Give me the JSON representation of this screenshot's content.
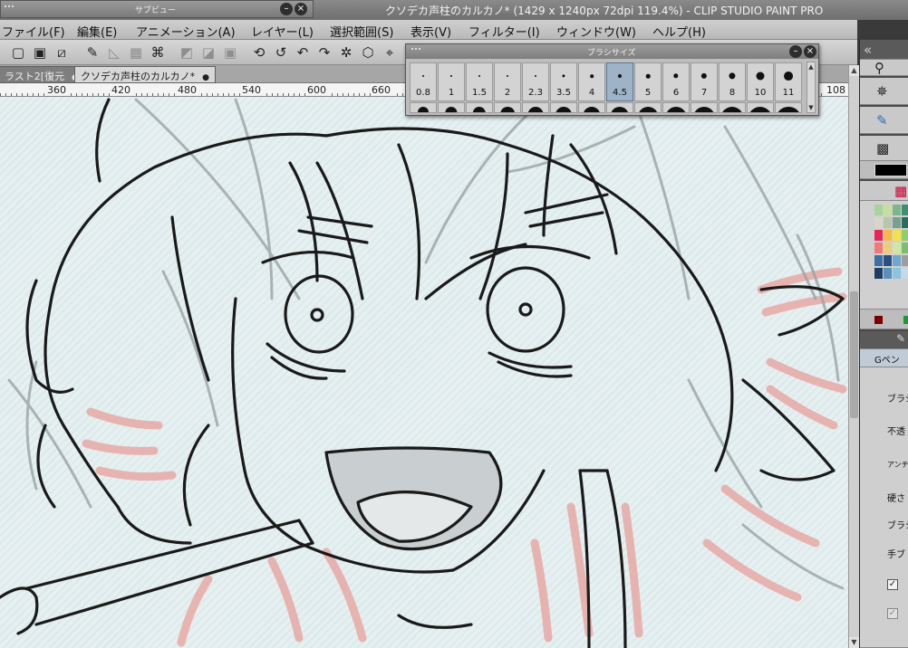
{
  "window": {
    "title": "クソデカ声柱のカルカノ* (1429 x 1240px 72dpi 119.4%)  - CLIP STUDIO PAINT PRO"
  },
  "subview": {
    "label": "サブビュー"
  },
  "menu": [
    "ファイル(F)",
    "編集(E)",
    "アニメーション(A)",
    "レイヤー(L)",
    "選択範囲(S)",
    "表示(V)",
    "フィルター(I)",
    "ウィンドウ(W)",
    "ヘルプ(H)"
  ],
  "tabs": [
    {
      "label": "ラスト2[復元",
      "active": false
    },
    {
      "label": "クソデカ声柱のカルカノ*",
      "active": true
    }
  ],
  "ruler": {
    "labels": [
      "360",
      "420",
      "480",
      "540",
      "600",
      "660",
      "108"
    ]
  },
  "brush_size_palette": {
    "title": "ブラシサイズ",
    "sizes": [
      "0.8",
      "1",
      "1.5",
      "2",
      "2.3",
      "3.5",
      "4",
      "4.5",
      "5",
      "6",
      "7",
      "8",
      "10",
      "11"
    ],
    "selected": "4.5"
  },
  "right_panel": {
    "brush_name": "Gペン",
    "props": [
      "ブラシ",
      "不透",
      "アンチ",
      "硬さ",
      "ブラシ",
      "手ブ"
    ],
    "colors": {
      "palette": [
        "#a8d39a",
        "#c9dd9e",
        "#7fb58c",
        "#3d8f74",
        "#d9d6c5",
        "#b7c7a8",
        "#7a9f8f",
        "#2a6d5d",
        "#e8245f",
        "#f6b84a",
        "#f2e14a",
        "#8fce6d",
        "#f07a7a",
        "#eccd7d",
        "#cfe6a6",
        "#7bbf6e",
        "#3e6ea6",
        "#2c4f7e",
        "#6fa8c8",
        "#9d9d9d",
        "#1b3e62",
        "#5a8fb9",
        "#8cc4de",
        "#c7d9e8"
      ]
    }
  }
}
